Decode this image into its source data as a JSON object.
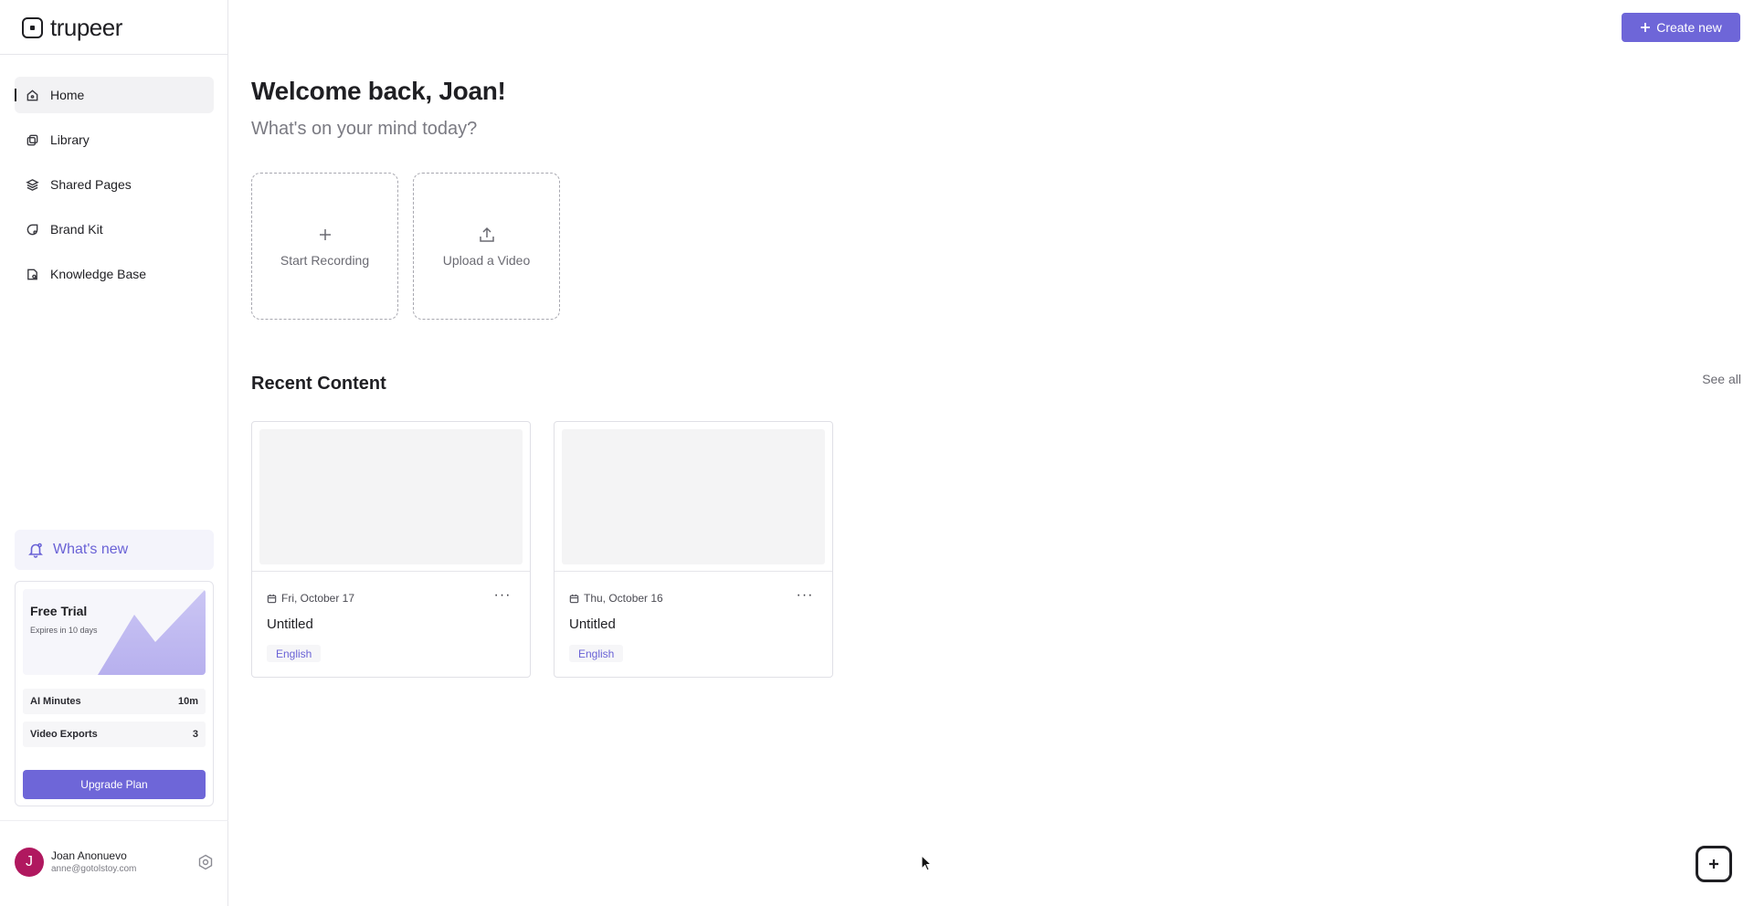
{
  "brand": {
    "name": "trupeer"
  },
  "sidebar": {
    "items": [
      {
        "label": "Home",
        "icon": "home-icon",
        "active": true
      },
      {
        "label": "Library",
        "icon": "library-icon"
      },
      {
        "label": "Shared Pages",
        "icon": "layers-icon"
      },
      {
        "label": "Brand Kit",
        "icon": "brand-kit-icon"
      },
      {
        "label": "Knowledge Base",
        "icon": "knowledge-base-icon"
      }
    ],
    "whats_new": "What's new",
    "trial": {
      "title": "Free Trial",
      "subtitle": "Expires in 10 days",
      "usage": [
        {
          "label": "AI Minutes",
          "value": "10m"
        },
        {
          "label": "Video Exports",
          "value": "3"
        }
      ],
      "upgrade_label": "Upgrade Plan"
    },
    "user": {
      "initial": "J",
      "name": "Joan Anonuevo",
      "email": "anne@gotolstoy.com"
    }
  },
  "header": {
    "create_label": "Create new"
  },
  "main": {
    "welcome": "Welcome back, Joan!",
    "subtitle": "What's on your mind today?",
    "actions": [
      {
        "label": "Start Recording",
        "icon": "plus-icon"
      },
      {
        "label": "Upload a Video",
        "icon": "upload-icon"
      }
    ],
    "recent": {
      "title": "Recent Content",
      "see_all": "See all",
      "items": [
        {
          "date": "Fri, October 17",
          "title": "Untitled",
          "language": "English",
          "menu": "···"
        },
        {
          "date": "Thu, October 16",
          "title": "Untitled",
          "language": "English",
          "menu": "···"
        }
      ]
    }
  },
  "colors": {
    "accent": "#6e66d8",
    "accent_text": "#6a62d6",
    "avatar": "#b0185f"
  }
}
